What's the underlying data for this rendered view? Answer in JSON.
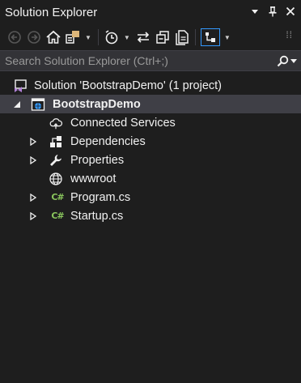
{
  "panel": {
    "title": "Solution Explorer",
    "title_actions": [
      "dropdown",
      "pin",
      "close"
    ]
  },
  "toolbar": {
    "buttons": [
      "back-icon",
      "forward-icon",
      "home-icon",
      "switch-views-icon",
      "pending-changes-icon",
      "sync-icon",
      "collapse-all-icon",
      "show-all-files-icon",
      "sync-with-active-document-icon"
    ]
  },
  "search": {
    "placeholder": "Search Solution Explorer (Ctrl+;)",
    "value": ""
  },
  "tree": {
    "solution": "Solution 'BootstrapDemo' (1 project)",
    "project": "BootstrapDemo",
    "items": [
      {
        "label": "Connected Services",
        "icon": "cloud-icon",
        "expandable": false
      },
      {
        "label": "Dependencies",
        "icon": "dependencies-icon",
        "expandable": true
      },
      {
        "label": "Properties",
        "icon": "wrench-icon",
        "expandable": true
      },
      {
        "label": "wwwroot",
        "icon": "globe-icon",
        "expandable": false
      },
      {
        "label": "Program.cs",
        "icon": "csharp-file-icon",
        "expandable": true
      },
      {
        "label": "Startup.cs",
        "icon": "csharp-file-icon",
        "expandable": true
      }
    ],
    "csharp_glyph": "C#"
  },
  "colors": {
    "background": "#1e1e1e",
    "search_background": "#333337",
    "selection": "#3f3f46",
    "accent": "#3399ff",
    "csharp": "#8ac65d",
    "vs_purple": "#b180d7"
  }
}
